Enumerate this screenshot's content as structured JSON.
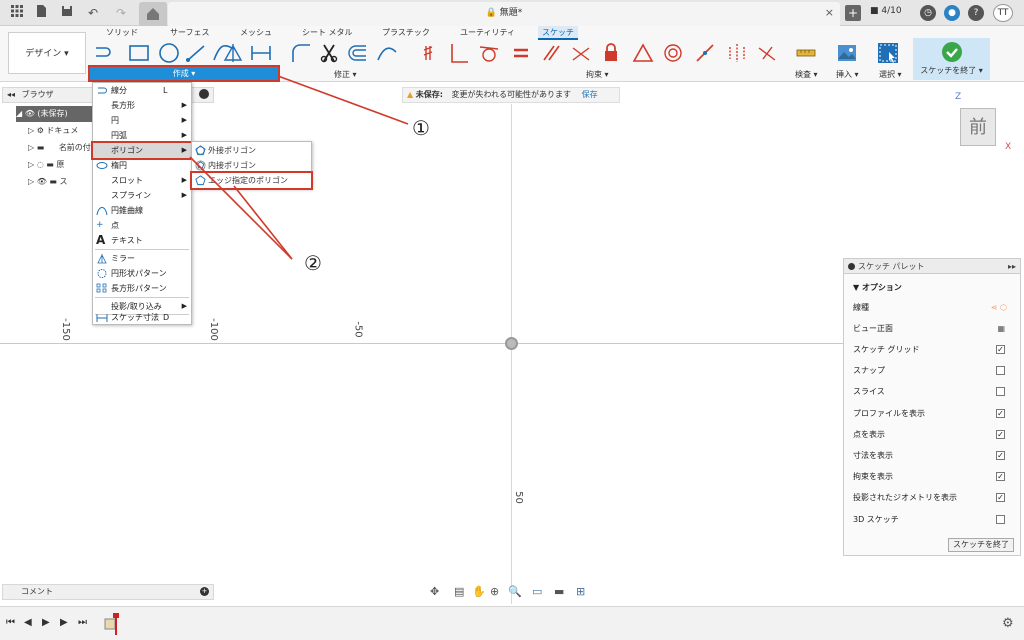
{
  "titlebar": {
    "doc_title": "無題*",
    "jobs": "4/10",
    "user": "TT",
    "close": "×",
    "add": "+"
  },
  "ribbon": {
    "workspace": "デザイン",
    "tabs": [
      "ソリッド",
      "サーフェス",
      "メッシュ",
      "シート メタル",
      "プラスチック",
      "ユーティリティ",
      "スケッチ"
    ],
    "groups": {
      "create": "作成",
      "modify": "修正",
      "constraints": "拘束",
      "inspect": "検査",
      "insert": "挿入",
      "select": "選択",
      "finish": "スケッチを終了"
    },
    "accent": "#1e8ed8",
    "constraint_color": "#d03a2a"
  },
  "browser": {
    "title": "ブラウザ",
    "items": [
      "(未保存)",
      "ドキュメ",
      "名前の付",
      "原",
      "ス"
    ]
  },
  "comments": {
    "title": "コメント"
  },
  "warning": {
    "label": "未保存:",
    "message": "変更が失われる可能性があります",
    "action": "保存"
  },
  "menu": {
    "items": [
      {
        "label": "線分",
        "key": "L"
      },
      {
        "label": "長方形",
        "sub": true
      },
      {
        "label": "円",
        "sub": true
      },
      {
        "label": "円弧",
        "sub": true
      },
      {
        "label": "ポリゴン",
        "sub": true
      },
      {
        "label": "楕円"
      },
      {
        "label": "スロット",
        "sub": true
      },
      {
        "label": "スプライン",
        "sub": true
      },
      {
        "label": "円錐曲線"
      },
      {
        "label": "点"
      },
      {
        "label": "テキスト"
      },
      {
        "label": "ミラー"
      },
      {
        "label": "円形状パターン"
      },
      {
        "label": "長方形パターン"
      },
      {
        "label": "投影/取り込み",
        "sub": true
      },
      {
        "label": "スケッチ寸法",
        "key": "D"
      }
    ],
    "submenu": [
      "外接ポリゴン",
      "内接ポリゴン",
      "エッジ指定のポリゴン"
    ]
  },
  "callouts": [
    "①",
    "②"
  ],
  "canvas": {
    "ticks_h": [
      "-150",
      "-100",
      "-50"
    ],
    "tick_v": "50",
    "viewcube": "前",
    "axis_z": "Z",
    "axis_x": "X"
  },
  "palette": {
    "title": "スケッチ パレット",
    "section": "オプション",
    "rows": [
      {
        "label": "線種",
        "type": "icon"
      },
      {
        "label": "ビュー正面",
        "type": "icon"
      },
      {
        "label": "スケッチ グリッド",
        "checked": "✓"
      },
      {
        "label": "スナップ",
        "checked": ""
      },
      {
        "label": "スライス",
        "checked": ""
      },
      {
        "label": "プロファイルを表示",
        "checked": "✓"
      },
      {
        "label": "点を表示",
        "checked": "✓"
      },
      {
        "label": "寸法を表示",
        "checked": "✓"
      },
      {
        "label": "拘束を表示",
        "checked": "✓"
      },
      {
        "label": "投影されたジオメトリを表示",
        "checked": "✓"
      },
      {
        "label": "3D スケッチ",
        "checked": ""
      }
    ],
    "finish": "スケッチを終了"
  }
}
